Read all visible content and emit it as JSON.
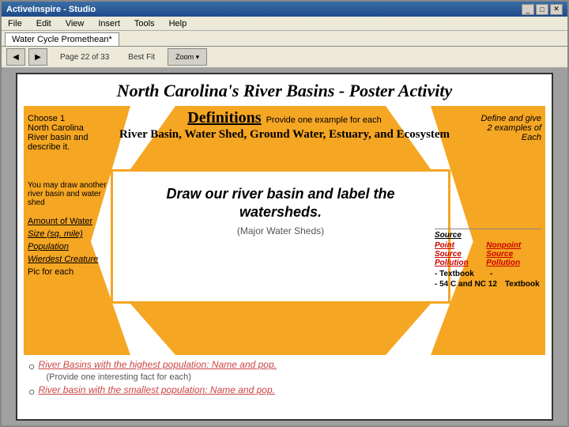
{
  "window": {
    "title": "ActiveInspire - Studio",
    "tab_label": "Water Cycle Promethean*"
  },
  "menu": {
    "items": [
      "File",
      "Edit",
      "View",
      "Insert",
      "Tools",
      "Help"
    ]
  },
  "toolbar": {
    "page_info": "Page 22 of 33",
    "fit_label": "Best Fit"
  },
  "poster": {
    "title": "North Carolina's River Basins - Poster Activity",
    "definitions_title": "Definitions",
    "provide_text": "Provide one example for each",
    "river_basin_heading": "River Basin, Water Shed, Ground Water, Estuary, and Ecosystem",
    "left_top": {
      "line1": "Choose 1",
      "line2": "North Carolina",
      "line3": "River basin and",
      "line4": "describe it."
    },
    "left_you_may": "You may draw another river basin and water shed",
    "left_bottom_items": [
      "Amount of Water",
      "Size (sq. mile)",
      "Population",
      "Wierdest Creature",
      "Pic for each"
    ],
    "right_top": {
      "line1": "Define and give",
      "line2": "2 examples of",
      "line3": "Each"
    },
    "right_source_label": "Source",
    "right_items": [
      {
        "label": "Point Source Pollution",
        "value": "Nonpoint Source Pollution"
      },
      {
        "label": "- Textbook",
        "value": "-"
      },
      {
        "label": "- 54 C and NC 12",
        "value": "Textbook"
      }
    ],
    "center_draw_main": "Draw our river basin and label the watersheds.",
    "center_draw_sub": "(Major Water Sheds)",
    "bottom_items": [
      {
        "bullet": "○",
        "text": " River Basins with the highest population: Name and pop.",
        "subtext": "(Provide one interesting fact for each)"
      },
      {
        "bullet": "○",
        "text": " River basin with the smallest population: Name and pop."
      }
    ]
  }
}
